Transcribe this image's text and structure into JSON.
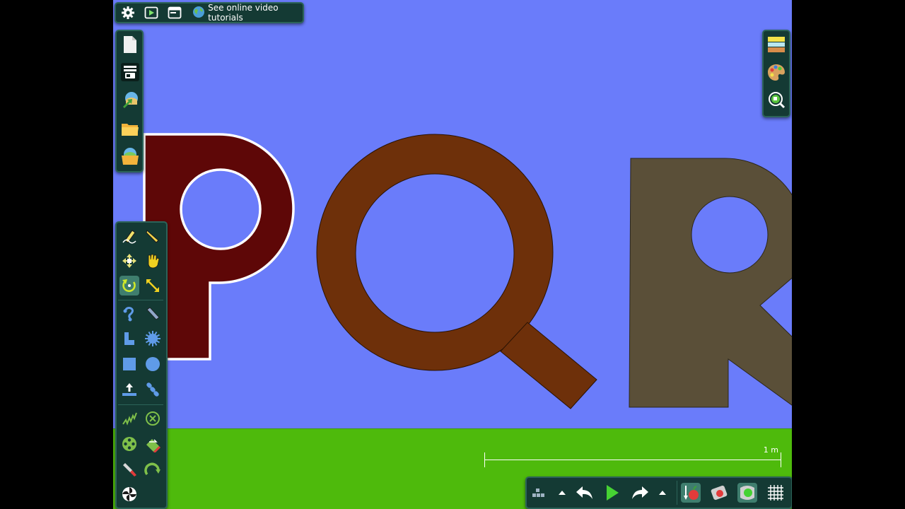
{
  "topbar": {
    "tutorial_label": "See online video tutorials",
    "icons": [
      "gear-icon",
      "play-icon",
      "window-icon",
      "globe-icon"
    ]
  },
  "scale_bar": {
    "label": "1 m"
  },
  "letters": [
    {
      "name": "P",
      "color": "#5e0707",
      "selected": true
    },
    {
      "name": "Q",
      "color": "#6e300a",
      "selected": false
    },
    {
      "name": "R",
      "color": "#5a4f38",
      "selected": false
    }
  ],
  "colors": {
    "sky": "#6a7cfa",
    "ground": "#4eba0c",
    "panel": "#143a34",
    "accent": "#cfe82a"
  },
  "left_panel": [
    "new-scene-icon",
    "menu-icon",
    "import-icon",
    "folder-icon",
    "save-icon"
  ],
  "right_panel": [
    "layers-icon",
    "palette-icon",
    "zoom-icon"
  ],
  "tool_panel": {
    "selected": "rotate-tool",
    "tools": [
      "sketch-tool",
      "knife-tool",
      "move-tool",
      "drag-tool",
      "rotate-tool",
      "scale-tool",
      "rope-tool",
      "plane-tool",
      "polygon-tool",
      "gear-tool",
      "box-tool",
      "circle-tool",
      "thruster-tool",
      "chain-tool",
      "spring-tool",
      "fixate-tool",
      "axle-tool",
      "eraser-tool",
      "laser-tool",
      "hinge-tool",
      "tracer-tool"
    ]
  },
  "bottom_toolbar": [
    "grid-toggle-icon",
    "up-arrow-icon",
    "undo-icon",
    "play-icon",
    "redo-icon",
    "up-arrow-icon",
    "gravity-icon",
    "air-friction-icon",
    "collision-icon",
    "grid-icon"
  ]
}
